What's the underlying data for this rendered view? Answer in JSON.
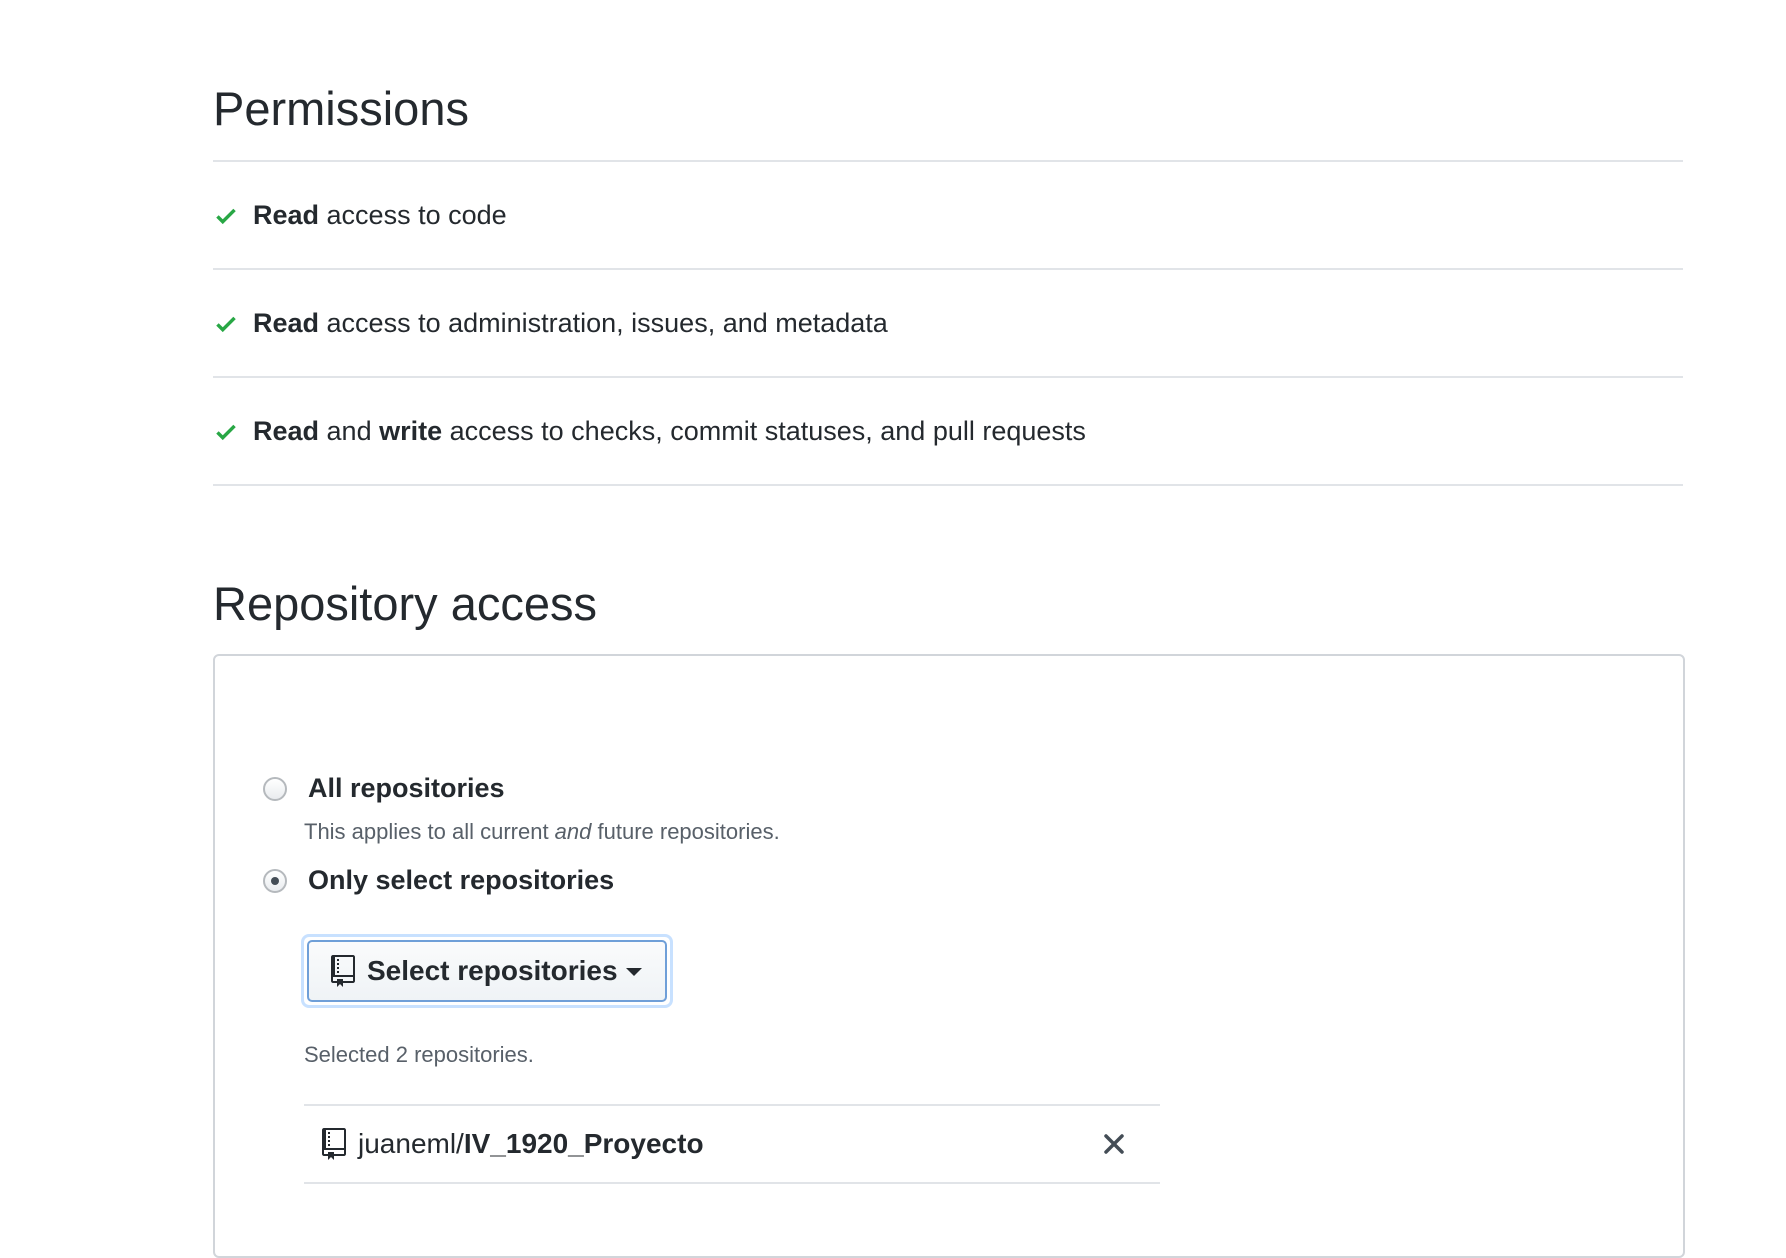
{
  "permissions": {
    "title": "Permissions",
    "items": [
      {
        "parts": [
          {
            "text": "Read",
            "bold": true
          },
          {
            "text": " access to code",
            "bold": false
          }
        ]
      },
      {
        "parts": [
          {
            "text": "Read",
            "bold": true
          },
          {
            "text": " access to administration, issues, and metadata",
            "bold": false
          }
        ]
      },
      {
        "parts": [
          {
            "text": "Read",
            "bold": true
          },
          {
            "text": " and ",
            "bold": false
          },
          {
            "text": "write",
            "bold": true
          },
          {
            "text": " access to checks, commit statuses, and pull requests",
            "bold": false
          }
        ]
      }
    ],
    "check_icon": "check-icon",
    "check_color": "#28a745"
  },
  "repository_access": {
    "title": "Repository access",
    "all_label": "All repositories",
    "all_note_pre": "This applies to all current ",
    "all_note_em": "and",
    "all_note_post": " future repositories.",
    "only_label": "Only select repositories",
    "selected_option": "only",
    "select_button_label": "Select repositories",
    "selected_count_text": "Selected 2 repositories.",
    "repos": [
      {
        "owner": "juaneml/",
        "name": "IV_1920_Proyecto"
      }
    ]
  },
  "colors": {
    "text": "#24292e",
    "muted": "#586069",
    "border": "#e1e4e8",
    "focus_ring": "#c8e1ff"
  }
}
